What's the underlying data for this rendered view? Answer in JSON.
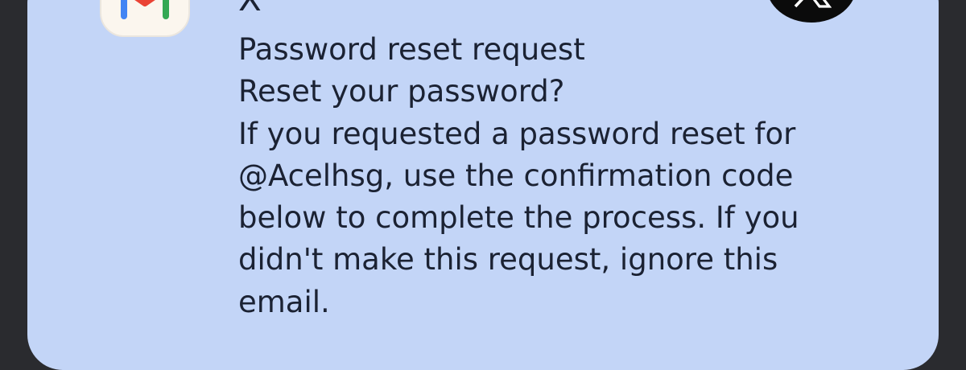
{
  "notification": {
    "app_icon": "gmail-icon",
    "sender": "X",
    "avatar_icon": "x-logo-icon",
    "subject": "Password reset request",
    "headline": "Reset your password?",
    "message_lines": [
      "If you requested a password reset for",
      "@Acelhsg, use the confirmation code",
      "below to complete the process. If you",
      "didn't make this request, ignore this",
      "email."
    ]
  },
  "colors": {
    "card_background": "#c3d5f7",
    "page_background": "#2a2b2f",
    "text": "#1b2233",
    "avatar_background": "#0b0b0b"
  }
}
